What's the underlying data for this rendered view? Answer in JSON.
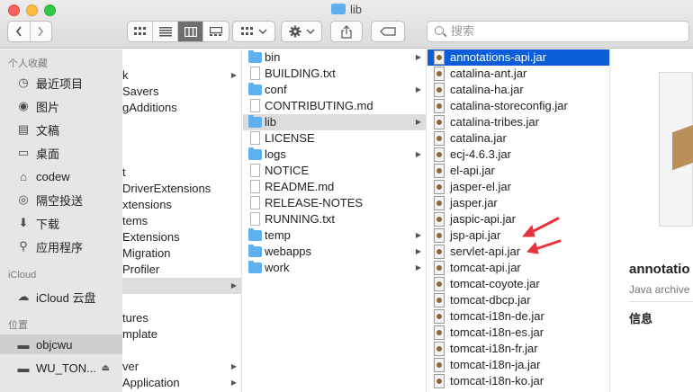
{
  "window": {
    "title": "lib"
  },
  "toolbar": {
    "back_icon": "chevron-left-icon",
    "forward_icon": "chevron-right-icon",
    "view_icons": [
      "icon-view-icon",
      "list-view-icon",
      "column-view-icon",
      "gallery-view-icon"
    ],
    "group_icon": "group-grid-icon",
    "action_icon": "gear-icon",
    "share_icon": "share-icon",
    "tag_icon": "tag-icon",
    "search_placeholder": "搜索"
  },
  "sidebar": {
    "sections": [
      {
        "header": "个人收藏",
        "items": [
          {
            "label": "最近项目",
            "icon": "recents-icon"
          },
          {
            "label": "图片",
            "icon": "camera-icon"
          },
          {
            "label": "文稿",
            "icon": "document-icon"
          },
          {
            "label": "桌面",
            "icon": "desktop-icon"
          },
          {
            "label": "codew",
            "icon": "home-icon"
          },
          {
            "label": "隔空投送",
            "icon": "airdrop-icon"
          },
          {
            "label": "下载",
            "icon": "download-icon"
          },
          {
            "label": "应用程序",
            "icon": "applications-icon"
          }
        ]
      },
      {
        "header": "iCloud",
        "items": [
          {
            "label": "iCloud 云盘",
            "icon": "cloud-icon"
          }
        ]
      },
      {
        "header": "位置",
        "items": [
          {
            "label": "objcwu",
            "icon": "drive-icon"
          },
          {
            "label": "WU_TON...",
            "icon": "drive-icon"
          }
        ]
      }
    ]
  },
  "column1": [
    "k",
    "Savers",
    "gAdditions",
    "",
    "",
    "",
    "t",
    "DriverExtensions",
    "xtensions",
    "tems",
    "Extensions",
    "Migration",
    "Profiler",
    "",
    "",
    "tures",
    "mplate",
    "",
    "ver",
    "Application"
  ],
  "column2": [
    {
      "name": "bin",
      "kind": "folder"
    },
    {
      "name": "BUILDING.txt",
      "kind": "doc"
    },
    {
      "name": "conf",
      "kind": "folder"
    },
    {
      "name": "CONTRIBUTING.md",
      "kind": "doc"
    },
    {
      "name": "lib",
      "kind": "folder"
    },
    {
      "name": "LICENSE",
      "kind": "doc"
    },
    {
      "name": "logs",
      "kind": "folder"
    },
    {
      "name": "NOTICE",
      "kind": "doc"
    },
    {
      "name": "README.md",
      "kind": "doc"
    },
    {
      "name": "RELEASE-NOTES",
      "kind": "doc"
    },
    {
      "name": "RUNNING.txt",
      "kind": "doc"
    },
    {
      "name": "temp",
      "kind": "folder"
    },
    {
      "name": "webapps",
      "kind": "folder"
    },
    {
      "name": "work",
      "kind": "folder"
    }
  ],
  "column3": [
    "annotations-api.jar",
    "catalina-ant.jar",
    "catalina-ha.jar",
    "catalina-storeconfig.jar",
    "catalina-tribes.jar",
    "catalina.jar",
    "ecj-4.6.3.jar",
    "el-api.jar",
    "jasper-el.jar",
    "jasper.jar",
    "jaspic-api.jar",
    "jsp-api.jar",
    "servlet-api.jar",
    "tomcat-api.jar",
    "tomcat-coyote.jar",
    "tomcat-dbcp.jar",
    "tomcat-i18n-de.jar",
    "tomcat-i18n-es.jar",
    "tomcat-i18n-fr.jar",
    "tomcat-i18n-ja.jar",
    "tomcat-i18n-ko.jar"
  ],
  "preview": {
    "name": "annotatio",
    "kind": "Java archive",
    "info_header": "信息"
  },
  "colors": {
    "selection": "#0a5fd8",
    "folder": "#5eb0ef",
    "annotation_arrow": "#e8323c"
  }
}
